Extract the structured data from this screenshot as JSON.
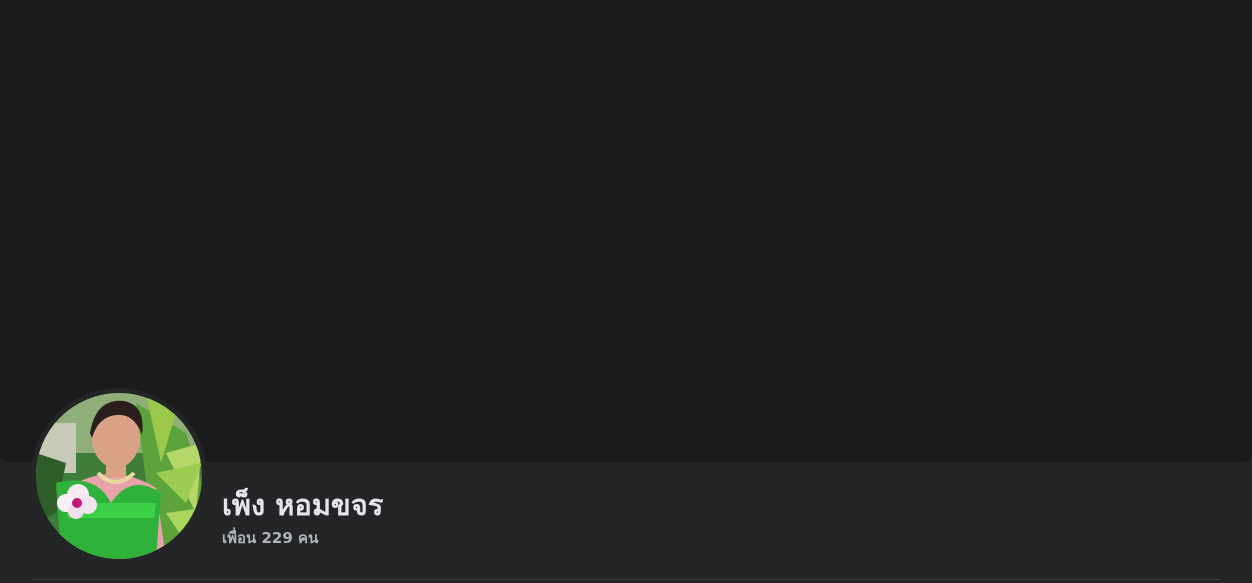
{
  "profile": {
    "name": "เพ็ง หอมขจร",
    "friends_count": "เพื่อน 229 คน"
  },
  "colors": {
    "cover": "#1a1b1d",
    "background": "#242526",
    "name_text": "#e4e6eb",
    "secondary_text": "#b0b3b8"
  }
}
